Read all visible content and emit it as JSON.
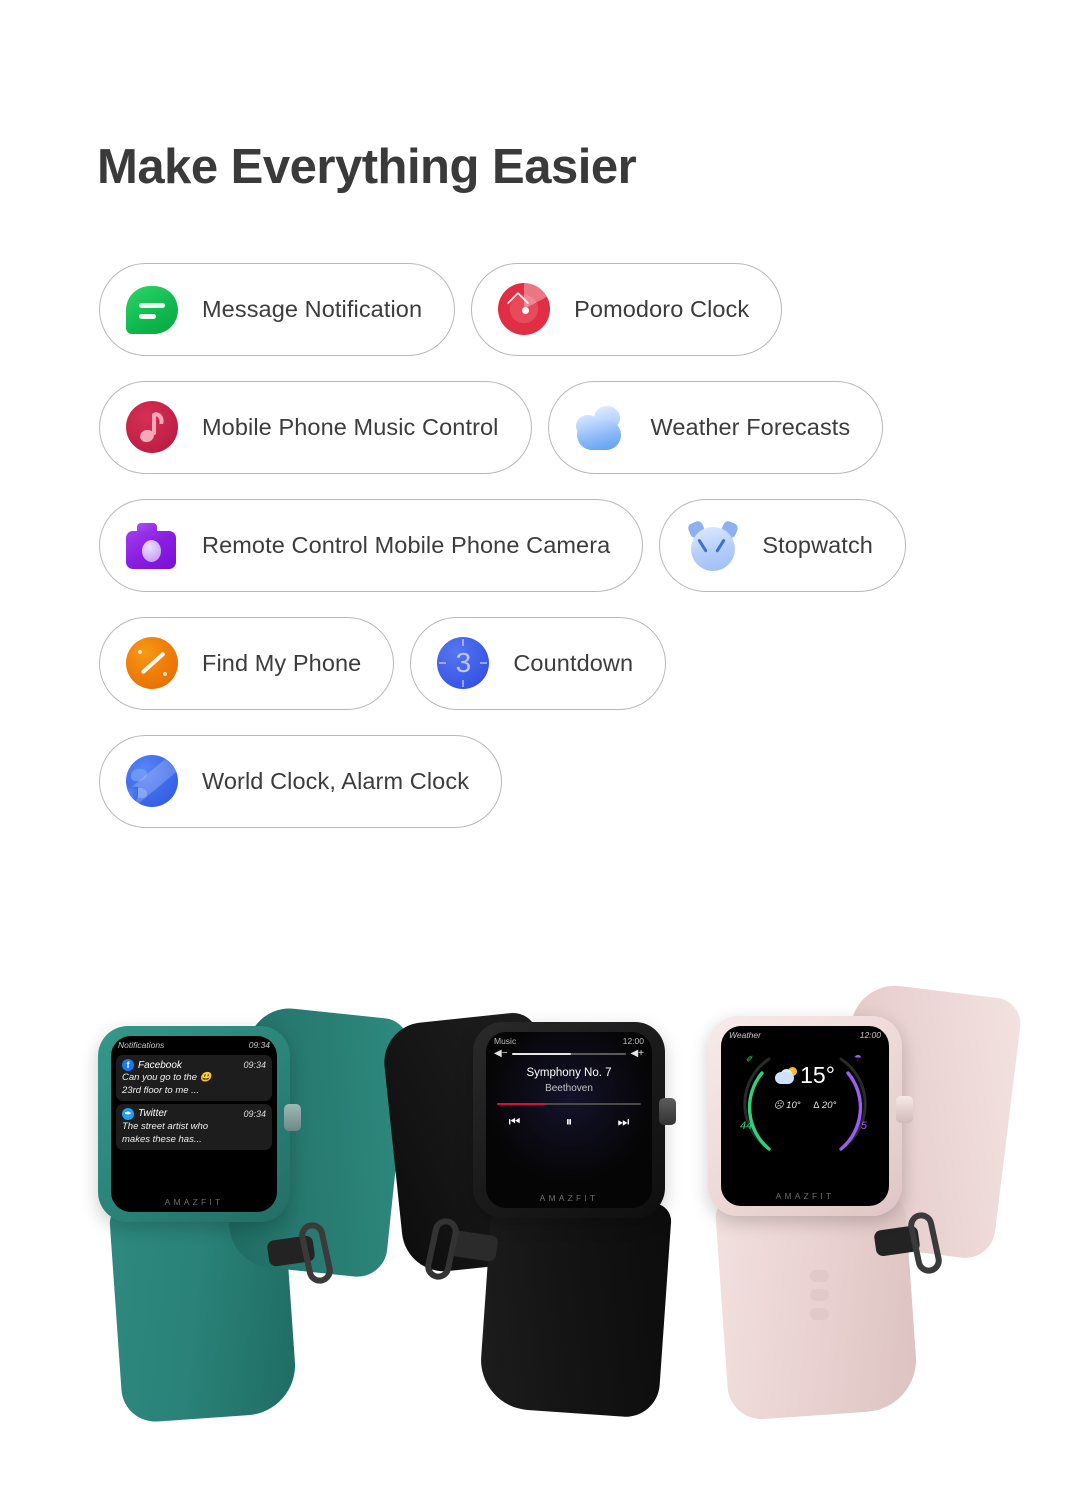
{
  "heading": "Make Everything Easier",
  "features": {
    "rows": [
      [
        {
          "icon": "message-bubble-icon",
          "label": "Message Notification"
        },
        {
          "icon": "pomodoro-timer-icon",
          "label": "Pomodoro Clock"
        }
      ],
      [
        {
          "icon": "music-note-icon",
          "label": "Mobile Phone Music Control"
        },
        {
          "icon": "cloud-icon",
          "label": "Weather Forecasts"
        }
      ],
      [
        {
          "icon": "camera-icon",
          "label": "Remote Control Mobile Phone Camera"
        },
        {
          "icon": "alarm-clock-icon",
          "label": "Stopwatch"
        }
      ],
      [
        {
          "icon": "radar-compass-icon",
          "label": "Find My Phone"
        },
        {
          "icon": "countdown-three-icon",
          "label": "Countdown"
        }
      ],
      [
        {
          "icon": "globe-icon",
          "label": "World Clock, Alarm Clock"
        }
      ]
    ]
  },
  "watches": [
    {
      "name": "green-watch",
      "color_strap": "#2a8278",
      "color_body": "#2f8d81",
      "brand": "AMAZFIT",
      "screen": {
        "type": "notifications",
        "header_title": "Notifications",
        "header_time": "09:34",
        "cards": [
          {
            "app": "Facebook",
            "badge": "f",
            "time": "09:34",
            "line1": "Can you go to the 😃",
            "line2": "23rd floor to me ..."
          },
          {
            "app": "Twitter",
            "badge": "✒",
            "time": "09:34",
            "line1": "The street artist who",
            "line2": "makes these has..."
          }
        ]
      }
    },
    {
      "name": "black-watch",
      "color_strap": "#161616",
      "color_body": "#1e1e1e",
      "brand": "AMAZFIT",
      "screen": {
        "type": "music",
        "header_title": "Music",
        "header_time": "12:00",
        "volume_down": "◀−",
        "volume_up": "◀+",
        "volume_percent": 52,
        "track_title": "Symphony No. 7",
        "artist": "Beethoven",
        "progress_percent": 33,
        "controls": [
          "⏮",
          "⏸",
          "⏭"
        ]
      }
    },
    {
      "name": "pink-watch",
      "color_strap": "#eed7d6",
      "color_body": "#f2dedd",
      "brand": "AMAZFIT",
      "screen": {
        "type": "weather",
        "header_title": "Weather",
        "header_time": "12:00",
        "temperature": "15°",
        "low": "☹ 10°",
        "high": "∆ 20°",
        "aqi_value": "44",
        "aqi_color": "#2fd07a",
        "uv_value": "5",
        "uv_color": "#9a5ef0",
        "leaf_icon": "✐",
        "umbrella_icon": "☂"
      }
    }
  ]
}
